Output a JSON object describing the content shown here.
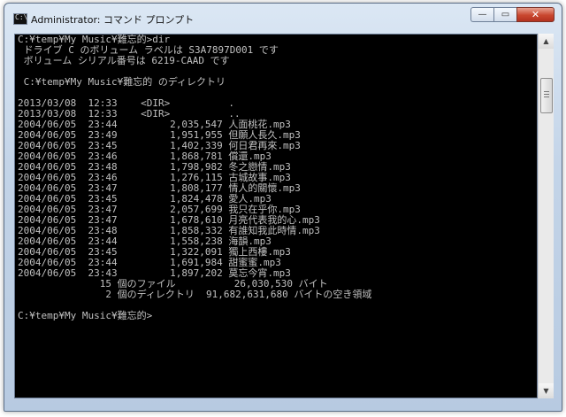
{
  "window": {
    "title": "Administrator: コマンド プロンプト",
    "icon": "cmd-icon",
    "icon_glyph": "C:\\",
    "controls": [
      "minimize-icon",
      "maximize-icon",
      "close-icon"
    ],
    "minimize_glyph": "—",
    "maximize_glyph": "▭",
    "close_glyph": "✕"
  },
  "console": {
    "colors": {
      "background": "#000000",
      "text": "#c0c0c0"
    },
    "lines": [
      "C:¥temp¥My Music¥難忘的>dir",
      " ドライブ C のボリューム ラベルは S3A7897D001 です",
      " ボリューム シリアル番号は 6219-CAAD です",
      "",
      " C:¥temp¥My Music¥難忘的 のディレクトリ",
      "",
      "2013/03/08  12:33    <DIR>          .",
      "2013/03/08  12:33    <DIR>          ..",
      "2004/06/05  23:44         2,035,547 人面桃花.mp3",
      "2004/06/05  23:49         1,951,955 但願人長久.mp3",
      "2004/06/05  23:45         1,402,339 何日君再來.mp3",
      "2004/06/05  23:46         1,868,781 償還.mp3",
      "2004/06/05  23:48         1,798,982 冬之戀情.mp3",
      "2004/06/05  23:46         1,276,115 古城故事.mp3",
      "2004/06/05  23:47         1,808,177 情人的關懷.mp3",
      "2004/06/05  23:45         1,824,478 愛人.mp3",
      "2004/06/05  23:47         2,057,699 我只在乎你.mp3",
      "2004/06/05  23:47         1,678,610 月亮代表我的心.mp3",
      "2004/06/05  23:48         1,858,332 有誰知我此時情.mp3",
      "2004/06/05  23:44         1,558,238 海韻.mp3",
      "2004/06/05  23:45         1,322,091 獨上西樓.mp3",
      "2004/06/05  23:44         1,691,984 甜蜜蜜.mp3",
      "2004/06/05  23:43         1,897,202 莫忘今宵.mp3",
      "              15 個のファイル          26,030,530 バイト",
      "               2 個のディレクトリ  91,682,631,680 バイトの空き領域",
      "",
      "C:¥temp¥My Music¥難忘的>"
    ]
  },
  "scrollbar": {
    "up_icon": "scroll-up-arrow-icon",
    "down_icon": "scroll-down-arrow-icon",
    "up_glyph": "▲",
    "down_glyph": "▼"
  }
}
